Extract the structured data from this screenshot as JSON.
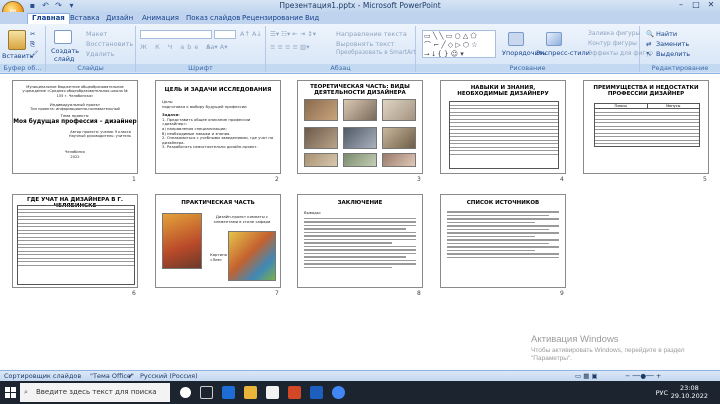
{
  "window": {
    "title": "Презентация1.pptx - Microsoft PowerPoint"
  },
  "tabs": [
    "Главная",
    "Вставка",
    "Дизайн",
    "Анимация",
    "Показ слайдов",
    "Рецензирование",
    "Вид"
  ],
  "ribbon": {
    "clipboard": {
      "paste": "Вставить",
      "cut": "",
      "label": "Буфер об..."
    },
    "slides": {
      "create": "Создать",
      "create2": "слайд",
      "layout": "Макет",
      "restore": "Восстановить",
      "delete": "Удалить",
      "label": "Слайды"
    },
    "font": {
      "label": "Шрифт"
    },
    "paragraph": {
      "text_dir": "Направление текста",
      "align_text": "Выровнять текст",
      "smartart": "Преобразовать в SmartArt",
      "label": "Абзац"
    },
    "drawing": {
      "arrange": "Упорядочить",
      "quick_styles": "Экспресс-стили",
      "fill": "Заливка фигуры",
      "outline": "Контур фигуры",
      "effects": "Эффекты для фигур",
      "label": "Рисование"
    },
    "editing": {
      "find": "Найти",
      "replace": "Заменить",
      "select": "Выделить",
      "label": "Редактирование"
    }
  },
  "slides": [
    {
      "num": "1",
      "lines": [
        "Муниципальное бюджетное общеобразовательное учреждение «Средняя общеобразовательная школа № 155 г. Челябинска»",
        "Индивидуальный проект",
        "Тип проекта: информационно-познавательный",
        "Тема проекта:",
        "Моя будущая профессия – дизайнер",
        "Автор проекта: ученик 9 класса",
        "Научный руководитель: учитель",
        "Челябинск",
        "2022"
      ]
    },
    {
      "num": "2",
      "title": "ЦЕЛЬ И ЗАДАЧИ ИССЛЕДОВАНИЯ",
      "lines": [
        "Цель:",
        "подготовка к выбору будущей профессии",
        "Задачи:",
        "1.    Представить    общее    описание    профессии «дизайнер»:",
        "а) направления специализации;",
        "б) необходимые навыки и знания.",
        "2.  Ознакомиться  с  учебными  заведениями,  где  учат на дизайнера.",
        "3. Разработать самостоятельно дизайн-проект."
      ]
    },
    {
      "num": "3",
      "title": "ТЕОРЕТИЧЕСКАЯ ЧАСТЬ: ВИДЫ ДЕЯТЕЛЬНОСТИ ДИЗАЙНЕРА"
    },
    {
      "num": "4",
      "title": "НАВЫКИ И ЗНАНИЯ, НЕОБХОДИМЫЕ ДИЗАЙНЕРУ"
    },
    {
      "num": "5",
      "title": "ПРЕИМУЩЕСТВА И НЕДОСТАТКИ ПРОФЕССИИ ДИЗАЙНЕР",
      "col1": "Плюсы",
      "col2": "Минусы"
    },
    {
      "num": "6",
      "title": "ГДЕ УЧАТ НА ДИЗАЙНЕРА В Г. ЧЕЛЯБИНСКЕ"
    },
    {
      "num": "7",
      "title": "ПРАКТИЧЕСКАЯ   ЧАСТЬ",
      "caption1": "Дизайн-проект комнаты с элементами в стиле сафари",
      "caption2": "Картина «Лев»"
    },
    {
      "num": "8",
      "title": "ЗАКЛЮЧЕНИЕ",
      "lines": [
        "Выводы:"
      ]
    },
    {
      "num": "9",
      "title": "СПИСОК   ИСТОЧНИКОВ"
    }
  ],
  "statusbar": {
    "sorter": "Сортировщик слайдов",
    "theme": "\"Тема Office\"",
    "lang": "Русский (Россия)"
  },
  "watermark": {
    "line1": "Активация Windows",
    "line2": "Чтобы активировать Windows, перейдите в раздел \"Параметры\"."
  },
  "taskbar": {
    "search": "Введите здесь текст для поиска",
    "lang": "РУС",
    "time": "23:08",
    "date": "29.10.2022"
  },
  "colors": {
    "accent": "#15428b",
    "ribbon": "#d5e4f6",
    "taskbar": "#1c2430"
  }
}
